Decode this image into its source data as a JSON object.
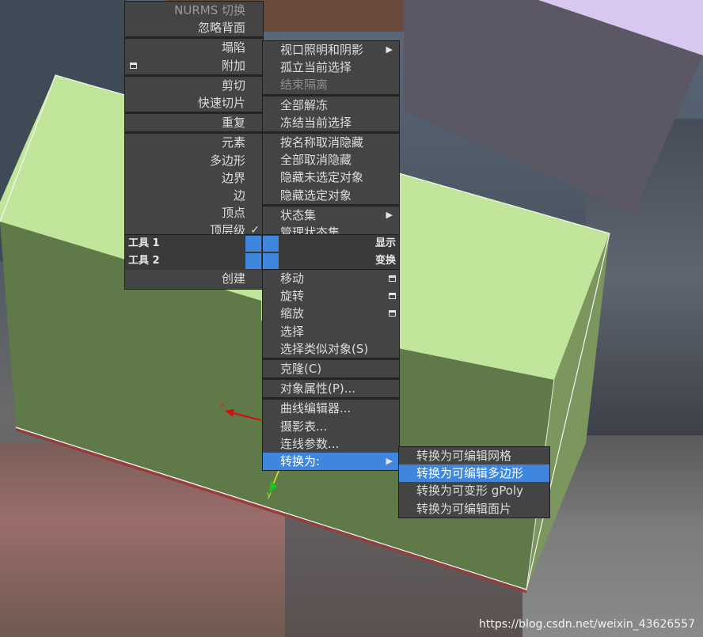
{
  "quad_left": {
    "items": [
      {
        "label": "NURMS 切换",
        "disabled": true
      },
      {
        "label": "忽略背面"
      },
      {
        "sep": true
      },
      {
        "label": "塌陷"
      },
      {
        "label": "附加",
        "box": true
      },
      {
        "sep": true
      },
      {
        "label": "剪切"
      },
      {
        "label": "快速切片"
      },
      {
        "sep": true
      },
      {
        "label": "重复"
      },
      {
        "sep": true
      },
      {
        "label": "元素"
      },
      {
        "label": "多边形"
      },
      {
        "label": "边界"
      },
      {
        "label": "边"
      },
      {
        "label": "顶点"
      },
      {
        "label": "顶层级",
        "check": true
      }
    ],
    "tools1": "工具 1",
    "tools2": "工具 2",
    "create": "创建"
  },
  "quad_right": {
    "items": [
      {
        "label": "视口照明和阴影",
        "submenu": true
      },
      {
        "label": "孤立当前选择"
      },
      {
        "label": "结束隔离",
        "disabled": true
      },
      {
        "sep": true
      },
      {
        "label": "全部解冻"
      },
      {
        "label": "冻结当前选择"
      },
      {
        "sep": true
      },
      {
        "label": "按名称取消隐藏"
      },
      {
        "label": "全部取消隐藏"
      },
      {
        "label": "隐藏未选定对象"
      },
      {
        "label": "隐藏选定对象"
      },
      {
        "sep": true
      },
      {
        "label": "状态集",
        "submenu": true
      },
      {
        "label": "管理状态集..."
      }
    ],
    "display": "显示",
    "transform": "变换",
    "bottom_items": [
      {
        "label": "移动",
        "box": true
      },
      {
        "label": "旋转",
        "box": true
      },
      {
        "label": "缩放",
        "box": true
      },
      {
        "label": "选择"
      },
      {
        "label": "选择类似对象(S)"
      },
      {
        "sep": true
      },
      {
        "label": "克隆(C)"
      },
      {
        "sep": true
      },
      {
        "label": "对象属性(P)..."
      },
      {
        "sep": true
      },
      {
        "label": "曲线编辑器..."
      },
      {
        "label": "摄影表..."
      },
      {
        "label": "连线参数..."
      },
      {
        "label": "转换为:",
        "submenu": true,
        "highlight": true
      }
    ]
  },
  "convert_submenu": {
    "items": [
      {
        "label": "转换为可编辑网格"
      },
      {
        "label": "转换为可编辑多边形",
        "highlight": true
      },
      {
        "label": "转换为可变形 gPoly"
      },
      {
        "label": "转换为可编辑面片"
      }
    ]
  },
  "gizmo": {
    "x_label": "x",
    "y_label": "y"
  },
  "watermark": "https://blog.csdn.net/weixin_43626557",
  "colors": {
    "highlight": "#3f86de",
    "menu_bg": "#444444",
    "box_top": "#c1e59a",
    "box_front": "#5f7a48",
    "box_side": "#7c975d"
  }
}
